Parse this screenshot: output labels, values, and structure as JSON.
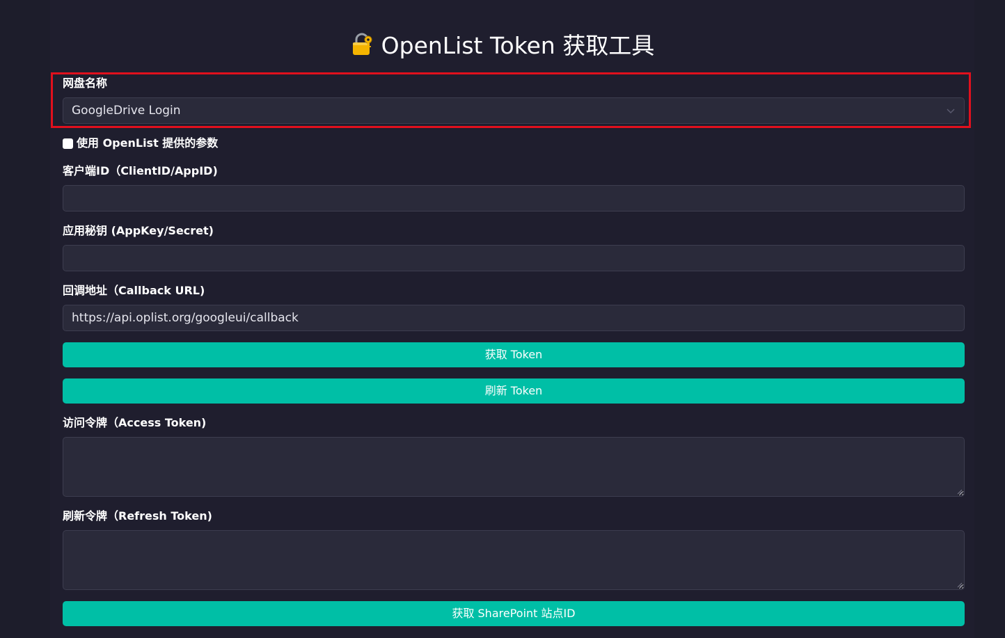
{
  "header": {
    "title": "OpenList Token 获取工具",
    "icon": "lock-with-key-icon"
  },
  "drive_name": {
    "label": "网盘名称",
    "selected": "GoogleDrive Login"
  },
  "use_openlist_params": {
    "label": "使用 OpenList 提供的参数",
    "checked": false
  },
  "client_id": {
    "label": "客户端ID（ClientID/AppID)",
    "value": ""
  },
  "app_secret": {
    "label": "应用秘钥 (AppKey/Secret)",
    "value": ""
  },
  "callback_url": {
    "label": "回调地址（Callback URL)",
    "value": "https://api.oplist.org/googleui/callback"
  },
  "buttons": {
    "get_token": "获取 Token",
    "refresh_token": "刷新 Token",
    "get_sharepoint": "获取 SharePoint 站点ID"
  },
  "access_token": {
    "label": "访问令牌（Access Token)",
    "value": ""
  },
  "refresh_token": {
    "label": "刷新令牌（Refresh Token)",
    "value": ""
  },
  "colors": {
    "background": "#1d1d2b",
    "input_bg": "#2a2a3a",
    "button": "#00bfa6",
    "highlight_border": "#e1101d"
  }
}
